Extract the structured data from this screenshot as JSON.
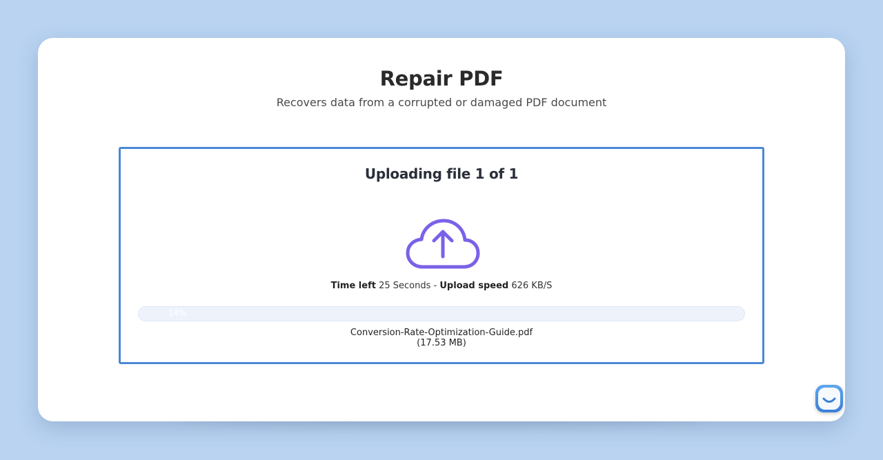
{
  "page": {
    "title": "Repair PDF",
    "subtitle": "Recovers data from a corrupted or damaged PDF document"
  },
  "upload": {
    "title": "Uploading file 1 of 1",
    "time_left_label": "Time left",
    "time_left_value": "25 Seconds",
    "separator": "-",
    "upload_speed_label": "Upload speed",
    "upload_speed_value": "626 KB/S",
    "progress_percent": 14,
    "progress_label": "14%",
    "file_name": "Conversion-Rate-Optimization-Guide.pdf",
    "file_size": "(17.53 MB)",
    "icon": "cloud-upload-icon"
  },
  "chat": {
    "icon": "chat-smile-icon"
  },
  "colors": {
    "background": "#b9d3f1",
    "box_border": "#4a87d6",
    "icon_purple": "#7b61e8",
    "progress_track": "#eef3fb"
  }
}
